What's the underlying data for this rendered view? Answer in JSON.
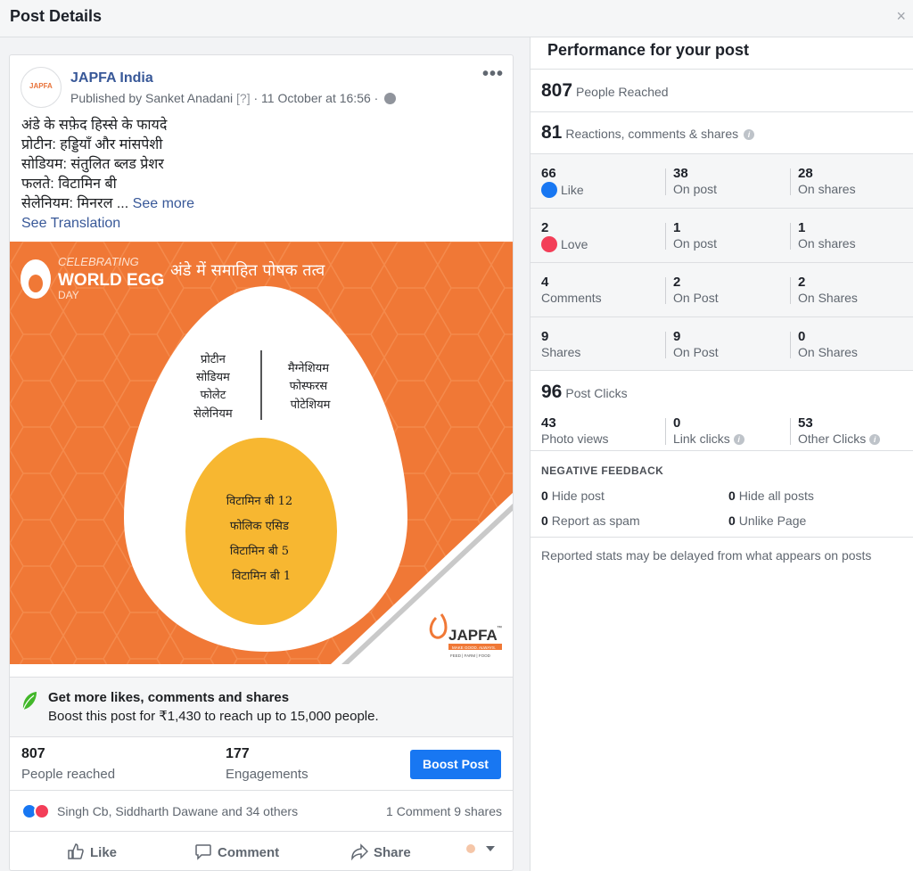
{
  "header": {
    "title": "Post Details",
    "close": "×"
  },
  "post": {
    "page_name": "JAPFA India",
    "avatar_text": "JAPFA",
    "published_by": "Published by Sanket Anadani",
    "help": "[?]",
    "timestamp": "· 11 October at 16:56 ·",
    "more": "•••",
    "lines": [
      "अंडे के सफ़ेद हिस्से के फायदे",
      "प्रोटीन: हड्डियाँ और मांसपेशी",
      "सोडियम: संतुलित ब्लड प्रेशर",
      "फलते: विटामिन बी",
      "सेलेनियम: मिनरल ..."
    ],
    "see_more": "See more",
    "see_translation": "See Translation",
    "image": {
      "badge_line1": "CELEBRATING",
      "badge_line2": "WORLD EGG",
      "badge_line3": "DAY",
      "headline": "अंडे में समाहित पोषक तत्व",
      "white_left": [
        "प्रोटीन",
        "सोडियम",
        "फोलेट",
        "सेलेनियम"
      ],
      "white_right": [
        "मैग्नेशियम",
        "फोस्फरस",
        "पोटेशियम"
      ],
      "yolk": [
        "विटामिन बी 12",
        "फोलिक एसिड",
        "विटामिन बी 5",
        "विटामिन बी 1"
      ],
      "logo": "JAPFA",
      "logo_tm": "™",
      "logo_tagline": "MAKE GOOD. ALWAYS.",
      "logo_sub": "FEED | FARM | FOOD"
    },
    "boost": {
      "title": "Get more likes, comments and shares",
      "text": "Boost this post for ₹1,430 to reach up to 15,000 people."
    },
    "stats": {
      "reached": "807",
      "reached_label": "People reached",
      "engagements": "177",
      "engagements_label": "Engagements",
      "boost_button": "Boost Post"
    },
    "reactions": {
      "names": "Singh Cb, Siddharth Dawane and 34 others",
      "counts": "1 Comment  9 shares"
    },
    "actions": {
      "like": "Like",
      "comment": "Comment",
      "share": "Share"
    }
  },
  "performance": {
    "title": "Performance for your post",
    "reached": {
      "value": "807",
      "label": "People Reached"
    },
    "reactions_total": {
      "value": "81",
      "label": "Reactions, comments & shares"
    },
    "rows": [
      {
        "total": "66",
        "label": "Like",
        "on_post": "38",
        "on_post_label": "On post",
        "on_shares": "28",
        "on_shares_label": "On shares"
      },
      {
        "total": "2",
        "label": "Love",
        "on_post": "1",
        "on_post_label": "On post",
        "on_shares": "1",
        "on_shares_label": "On shares"
      },
      {
        "total": "4",
        "label": "Comments",
        "on_post": "2",
        "on_post_label": "On Post",
        "on_shares": "2",
        "on_shares_label": "On Shares"
      },
      {
        "total": "9",
        "label": "Shares",
        "on_post": "9",
        "on_post_label": "On Post",
        "on_shares": "0",
        "on_shares_label": "On Shares"
      }
    ],
    "clicks": {
      "value": "96",
      "label": "Post Clicks",
      "photo": "43",
      "photo_label": "Photo views",
      "link": "0",
      "link_label": "Link clicks",
      "other": "53",
      "other_label": "Other Clicks"
    },
    "negative": {
      "title": "NEGATIVE FEEDBACK",
      "hide_post": "0",
      "hide_post_label": "Hide post",
      "hide_all": "0",
      "hide_all_label": "Hide all posts",
      "spam": "0",
      "spam_label": "Report as spam",
      "unlike": "0",
      "unlike_label": "Unlike Page"
    },
    "footnote": "Reported stats may be delayed from what appears on posts"
  },
  "colors": {
    "accent": "#1877f2",
    "link": "#385898",
    "orange": "#f07836",
    "yolk": "#f7b731"
  }
}
